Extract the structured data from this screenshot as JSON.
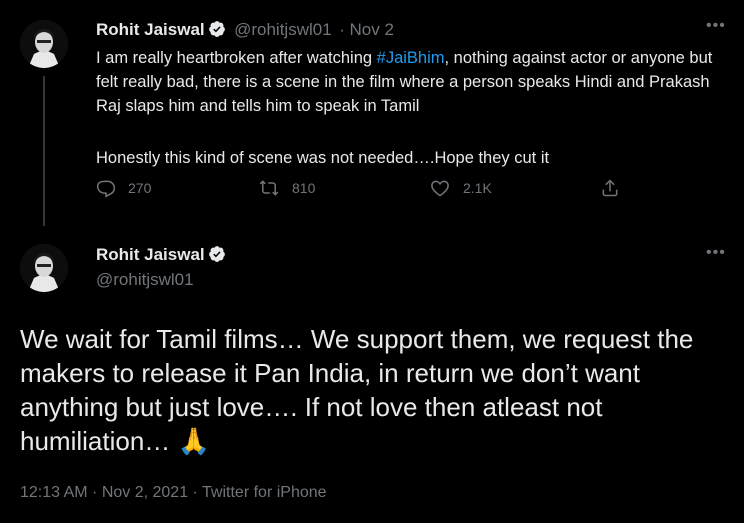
{
  "tweet1": {
    "name": "Rohit Jaiswal",
    "handle": "@rohitjswl01",
    "date": "· Nov 2",
    "text_before_tag": "I am really heartbroken after watching ",
    "hashtag": "#JaiBhim",
    "text_after_tag": ", nothing against actor or anyone but felt really bad, there is a scene in the film where a person speaks Hindi and Prakash Raj slaps him and tells him to speak in Tamil",
    "text_second": "Honestly this kind of scene was not needed….Hope they cut it",
    "replies": "270",
    "retweets": "810",
    "likes": "2.1K"
  },
  "tweet2": {
    "name": "Rohit Jaiswal",
    "handle": "@rohitjswl01",
    "text": "We wait for Tamil films… We support them, we request the makers to release it Pan India, in return we don’t want anything but just love…. If not love then atleast not humiliation… 🙏",
    "time": "12:13 AM · Nov 2, 2021 · Twitter for iPhone"
  },
  "colors": {
    "background": "#000000",
    "text": "#e7e9ea",
    "secondary": "#71767b",
    "accent": "#1d9bf0"
  },
  "icons": [
    "verified-icon",
    "more-icon",
    "reply-icon",
    "retweet-icon",
    "like-icon",
    "share-icon"
  ]
}
